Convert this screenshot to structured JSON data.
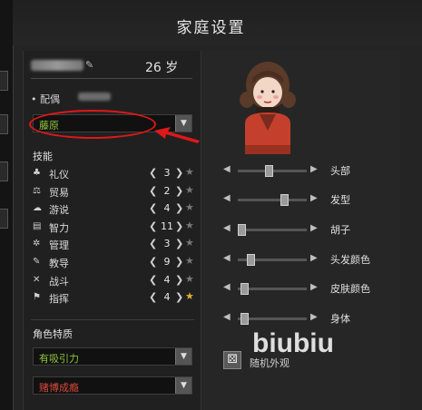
{
  "window": {
    "title": "家庭设置"
  },
  "character": {
    "age": "26 岁"
  },
  "spouse": {
    "label": "• 配偶",
    "trait_value": "藤原"
  },
  "skills": {
    "heading": "技能",
    "items": [
      {
        "name": "礼仪",
        "value": "3",
        "icon": "etiquette-icon",
        "starred": false
      },
      {
        "name": "贸易",
        "value": "2",
        "icon": "trade-icon",
        "starred": false
      },
      {
        "name": "游说",
        "value": "4",
        "icon": "persuasion-icon",
        "starred": false
      },
      {
        "name": "智力",
        "value": "11",
        "icon": "intellect-icon",
        "starred": false
      },
      {
        "name": "管理",
        "value": "3",
        "icon": "management-icon",
        "starred": false
      },
      {
        "name": "教导",
        "value": "9",
        "icon": "teaching-icon",
        "starred": false
      },
      {
        "name": "战斗",
        "value": "4",
        "icon": "combat-icon",
        "starred": false
      },
      {
        "name": "指挥",
        "value": "4",
        "icon": "command-icon",
        "starred": true
      }
    ]
  },
  "traits": {
    "heading": "角色特质",
    "first": {
      "value": "有吸引力",
      "color": "#8fc23c"
    },
    "second": {
      "value": "赌博成瘾",
      "color": "#d84a3a"
    }
  },
  "appearance": {
    "sliders": [
      {
        "label": "头部",
        "value": 0.45
      },
      {
        "label": "发型",
        "value": 0.7
      },
      {
        "label": "胡子",
        "value": 0.0
      },
      {
        "label": "头发颜色",
        "value": 0.15
      },
      {
        "label": "皮肤颜色",
        "value": 0.05
      },
      {
        "label": "身体",
        "value": 0.05
      }
    ],
    "random_label": "随机外观"
  },
  "watermark": "biubiu",
  "colors": {
    "annotation": "#e01818",
    "star_gold": "#e0b030"
  }
}
